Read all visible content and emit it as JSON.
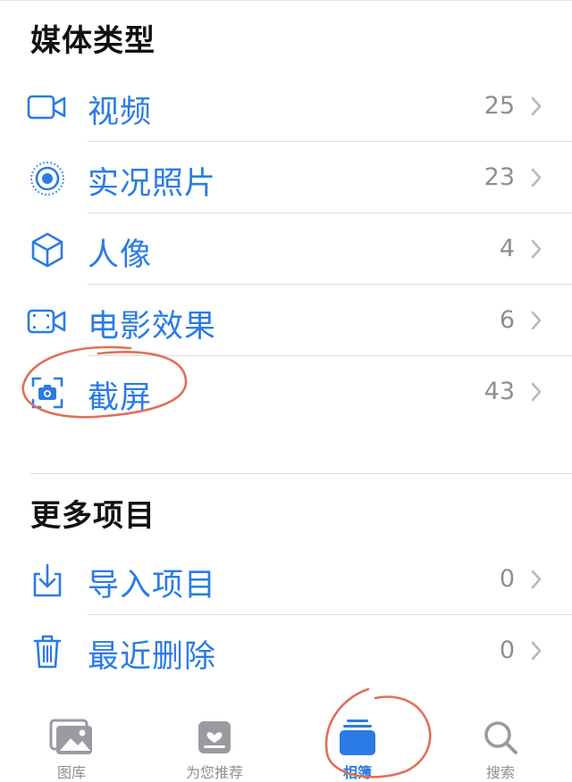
{
  "sections": {
    "media_types": {
      "title": "媒体类型",
      "items": [
        {
          "label": "视频",
          "count": "25",
          "icon": "video-icon"
        },
        {
          "label": "实况照片",
          "count": "23",
          "icon": "live-photo-icon"
        },
        {
          "label": "人像",
          "count": "4",
          "icon": "portrait-cube-icon"
        },
        {
          "label": "电影效果",
          "count": "6",
          "icon": "cinematic-icon"
        },
        {
          "label": "截屏",
          "count": "43",
          "icon": "screenshot-icon"
        }
      ]
    },
    "more_items": {
      "title": "更多项目",
      "items": [
        {
          "label": "导入项目",
          "count": "0",
          "icon": "import-icon"
        },
        {
          "label": "最近删除",
          "count": "0",
          "icon": "trash-icon"
        }
      ]
    }
  },
  "tabbar": {
    "tabs": [
      {
        "label": "图库",
        "icon": "photos-library-icon",
        "active": false
      },
      {
        "label": "为您推荐",
        "icon": "for-you-icon",
        "active": false
      },
      {
        "label": "相簿",
        "icon": "albums-icon",
        "active": true
      },
      {
        "label": "搜索",
        "icon": "search-icon",
        "active": false
      }
    ]
  },
  "colors": {
    "accent": "#2a7be6",
    "secondary_text": "#8e8e93",
    "annotation": "#e0705a"
  }
}
